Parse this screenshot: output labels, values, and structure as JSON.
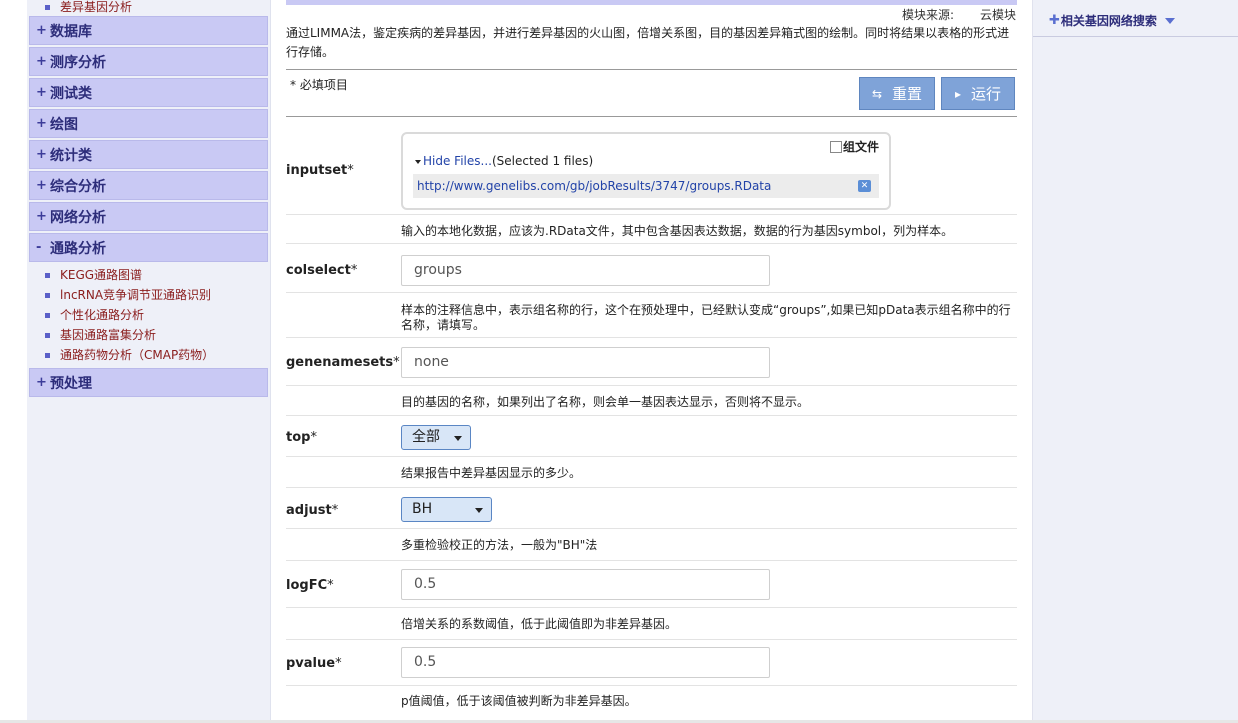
{
  "sidebar": {
    "top_sub_items": [
      {
        "label": "差异基因分析"
      }
    ],
    "categories": [
      {
        "sign": "+",
        "label": "数据库"
      },
      {
        "sign": "+",
        "label": "测序分析"
      },
      {
        "sign": "+",
        "label": "测试类"
      },
      {
        "sign": "+",
        "label": "绘图"
      },
      {
        "sign": "+",
        "label": "统计类"
      },
      {
        "sign": "+",
        "label": "综合分析"
      },
      {
        "sign": "+",
        "label": "网络分析"
      },
      {
        "sign": "-",
        "label": "通路分析"
      },
      {
        "sign": "+",
        "label": "预处理"
      }
    ],
    "pathway_items": [
      {
        "label": "KEGG通路图谱"
      },
      {
        "label": "lncRNA竞争调节亚通路识别"
      },
      {
        "label": "个性化通路分析"
      },
      {
        "label": "基因通路富集分析"
      },
      {
        "label": "通路药物分析（CMAP药物）"
      }
    ]
  },
  "main": {
    "source_label": "模块来源:",
    "source_value": "云模块",
    "description": "通过LIMMA法，鉴定疾病的差异基因，并进行差异基因的火山图，倍增关系图，目的基因差异箱式图的绘制。同时将结果以表格的形式进行存储。",
    "required_note": "* 必填项目",
    "reset_label": "重置",
    "run_label": "运行",
    "reset_icon": "refresh-icon",
    "run_icon": "play-icon"
  },
  "form": {
    "inputset": {
      "label": "inputset",
      "star": "*",
      "group_files_label": "组文件",
      "hide_files": "Hide Files...",
      "selected_count": "(Selected 1 files)",
      "file_url": "http://www.genelibs.com/gb/jobResults/3747/groups.RData",
      "hint": "输入的本地化数据，应该为.RData文件，其中包含基因表达数据，数据的行为基因symbol，列为样本。"
    },
    "colselect": {
      "label": "colselect",
      "star": "*",
      "value": "groups",
      "hint": "样本的注释信息中，表示组名称的行，这个在预处理中，已经默认变成“groups”,如果已知pData表示组名称中的行名称，请填写。"
    },
    "genenamesets": {
      "label": "genenamesets",
      "star": "*",
      "value": "none",
      "hint": "目的基因的名称，如果列出了名称，则会单一基因表达显示，否则将不显示。"
    },
    "top": {
      "label": "top",
      "star": "*",
      "selected": "全部",
      "hint": "结果报告中差异基因显示的多少。"
    },
    "adjust": {
      "label": "adjust",
      "star": "*",
      "selected": "BH",
      "hint": "多重检验校正的方法，一般为\"BH\"法"
    },
    "logFC": {
      "label": "logFC",
      "star": "*",
      "value": "0.5",
      "hint": "倍增关系的系数阈值，低于此阈值即为非差异基因。"
    },
    "pvalue": {
      "label": "pvalue",
      "star": "*",
      "value": "0.5",
      "hint": "p值阈值，低于该阈值被判断为非差异基因。"
    }
  },
  "right": {
    "related_label": "相关基因网络搜索"
  }
}
